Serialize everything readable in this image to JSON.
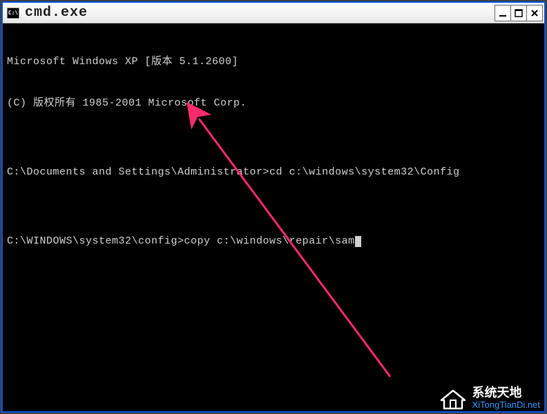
{
  "window": {
    "title": "cmd.exe",
    "icon_label": "C:\\"
  },
  "terminal": {
    "lines": [
      "Microsoft Windows XP [版本 5.1.2600]",
      "(C) 版权所有 1985-2001 Microsoft Corp.",
      "",
      "C:\\Documents and Settings\\Administrator>cd c:\\windows\\system32\\Config",
      "",
      "C:\\WINDOWS\\system32\\config>copy c:\\windows\\repair\\sam"
    ]
  },
  "annotation": {
    "arrow_color": "#ff2a6d"
  },
  "watermark": {
    "main": "系统天地",
    "sub": "XiTongTianDi.net"
  }
}
